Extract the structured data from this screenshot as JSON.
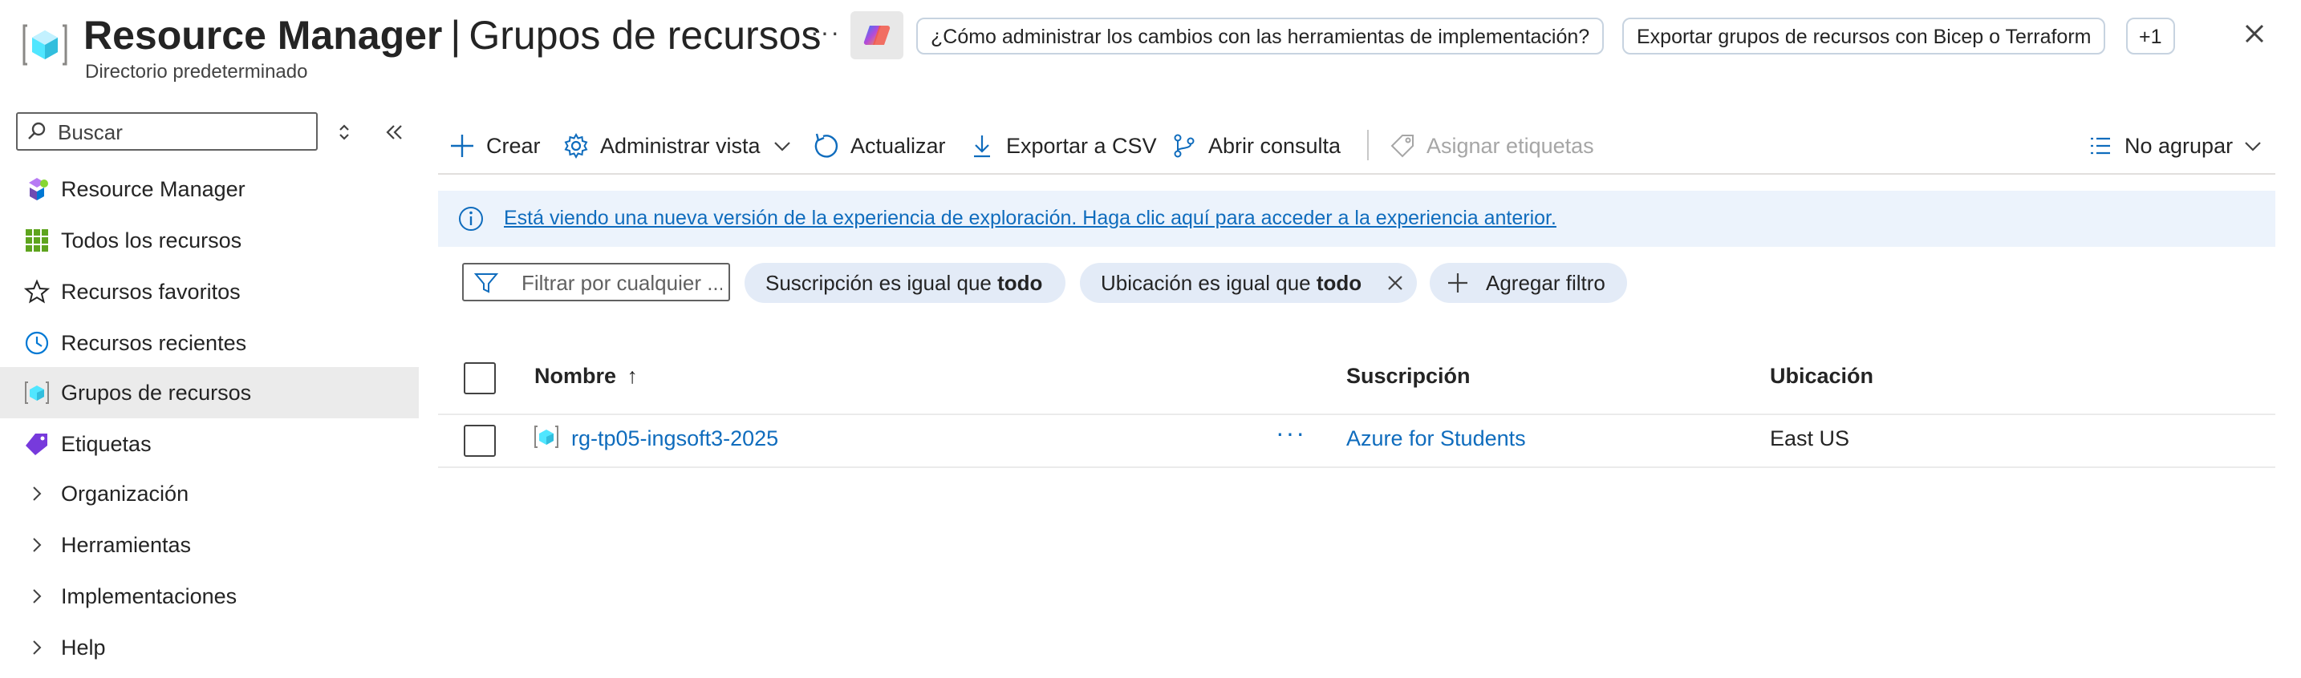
{
  "header": {
    "title_bold": "Resource Manager",
    "title_sep": "|",
    "title_rest": "Grupos de recursos",
    "subtitle": "Directorio predeterminado",
    "more": "···",
    "pills": [
      "¿Cómo administrar los cambios con las herramientas de implementación?",
      "Exportar grupos de recursos con Bicep o Terraform",
      "+1"
    ]
  },
  "sidebar": {
    "search_placeholder": "Buscar",
    "items": [
      {
        "label": "Resource Manager",
        "icon": "resource-manager-icon"
      },
      {
        "label": "Todos los recursos",
        "icon": "grid-icon"
      },
      {
        "label": "Recursos favoritos",
        "icon": "star-icon"
      },
      {
        "label": "Recursos recientes",
        "icon": "clock-icon"
      },
      {
        "label": "Grupos de recursos",
        "icon": "resource-group-icon",
        "active": true
      },
      {
        "label": "Etiquetas",
        "icon": "tag-icon"
      },
      {
        "label": "Organización",
        "icon": "chevron-right-icon"
      },
      {
        "label": "Herramientas",
        "icon": "chevron-right-icon"
      },
      {
        "label": "Implementaciones",
        "icon": "chevron-right-icon"
      },
      {
        "label": "Help",
        "icon": "chevron-right-icon"
      }
    ]
  },
  "toolbar": {
    "create": "Crear",
    "manage_view": "Administrar vista",
    "refresh": "Actualizar",
    "export_csv": "Exportar a CSV",
    "open_query": "Abrir consulta",
    "assign_tags": "Asignar etiquetas",
    "grouping": "No agrupar"
  },
  "banner": {
    "text": "Está viendo una nueva versión de la experiencia de exploración. Haga clic aquí para acceder a la experiencia anterior."
  },
  "filters": {
    "placeholder": "Filtrar por cualquier ...",
    "chips": [
      {
        "field": "Suscripción",
        "op": "es igual que",
        "value": "todo"
      },
      {
        "field": "Ubicación",
        "op": "es igual que",
        "value": "todo"
      }
    ],
    "add_filter": "Agregar filtro"
  },
  "table": {
    "columns": {
      "name": "Nombre",
      "sort_indicator": "↑",
      "subscription": "Suscripción",
      "location": "Ubicación"
    },
    "rows": [
      {
        "name": "rg-tp05-ingsoft3-2025",
        "more": "···",
        "subscription": "Azure for Students",
        "location": "East US"
      }
    ]
  },
  "colors": {
    "accent": "#0f6cbd",
    "banner_bg": "#ecf3fc",
    "chip_bg": "#e3ebf7",
    "active_nav_bg": "#ebebeb"
  }
}
